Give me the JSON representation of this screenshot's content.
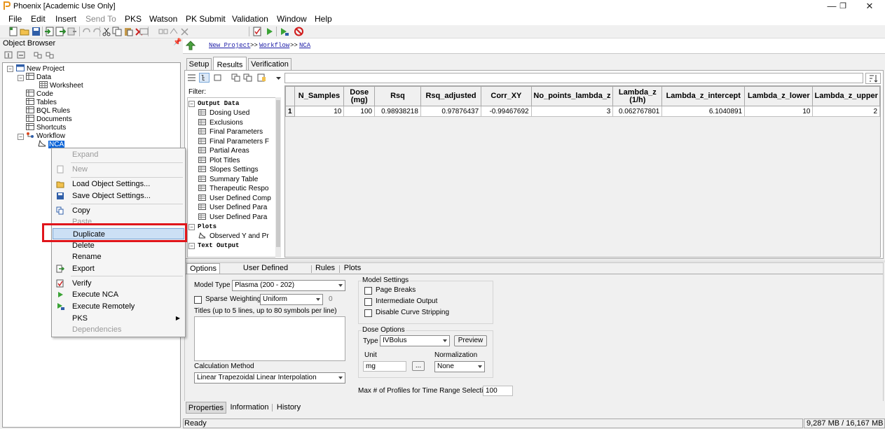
{
  "window": {
    "title": "Phoenix [Academic Use Only]"
  },
  "menu": [
    "File",
    "Edit",
    "Insert",
    "Send To",
    "PKS",
    "Watson",
    "PK Submit",
    "Validation",
    "Window",
    "Help"
  ],
  "object_browser": {
    "title": "Object Browser",
    "tree": [
      {
        "label": "New Project"
      },
      {
        "label": "Data"
      },
      {
        "label": "Worksheet"
      },
      {
        "label": "Code"
      },
      {
        "label": "Tables"
      },
      {
        "label": "BQL Rules"
      },
      {
        "label": "Documents"
      },
      {
        "label": "Shortcuts"
      },
      {
        "label": "Workflow"
      },
      {
        "label": "NCA"
      }
    ]
  },
  "context_menu": {
    "items": [
      {
        "label": "Expand"
      },
      {
        "label": "New"
      },
      {
        "label": "Load Object Settings..."
      },
      {
        "label": "Save Object Settings..."
      },
      {
        "label": "Copy"
      },
      {
        "label": "Paste"
      },
      {
        "label": "Duplicate"
      },
      {
        "label": "Delete"
      },
      {
        "label": "Rename"
      },
      {
        "label": "Export"
      },
      {
        "label": "Verify"
      },
      {
        "label": "Execute NCA"
      },
      {
        "label": "Execute Remotely"
      },
      {
        "label": "PKS"
      },
      {
        "label": "Dependencies"
      }
    ]
  },
  "breadcrumb": [
    "New Project",
    "Workflow",
    "NCA"
  ],
  "breadcrumb_sep": ">>",
  "top_tabs": [
    "Setup",
    "Results",
    "Verification"
  ],
  "results": {
    "filter_label": "Filter:",
    "output_tree": [
      {
        "label": "Output Data"
      },
      {
        "label": "Dosing Used"
      },
      {
        "label": "Exclusions"
      },
      {
        "label": "Final Parameters"
      },
      {
        "label": "Final Parameters F"
      },
      {
        "label": "Partial Areas"
      },
      {
        "label": "Plot Titles"
      },
      {
        "label": "Slopes Settings"
      },
      {
        "label": "Summary Table"
      },
      {
        "label": "Therapeutic Respo"
      },
      {
        "label": "User Defined Comp"
      },
      {
        "label": "User Defined Para"
      },
      {
        "label": "User Defined Para"
      },
      {
        "label": "Plots"
      },
      {
        "label": "Observed Y and Pr"
      },
      {
        "label": "Text Output"
      }
    ],
    "grid": {
      "columns": [
        "N_Samples",
        "Dose (mg)",
        "Rsq",
        "Rsq_adjusted",
        "Corr_XY",
        "No_points_lambda_z",
        "Lambda_z (1/h)",
        "Lambda_z_intercept",
        "Lambda_z_lower",
        "Lambda_z_upper"
      ],
      "rows": [
        [
          "1",
          "10",
          "100",
          "0.98938218",
          "0.97876437",
          "-0.99467692",
          "3",
          "0.062767801",
          "6.1040891",
          "10",
          "2"
        ]
      ]
    }
  },
  "props": {
    "tabs": [
      "Options",
      "User Defined Parameters",
      "Rules",
      "Plots"
    ],
    "model_type_label": "Model Type",
    "model_type_value": "Plasma (200 - 202)",
    "sparse_label": "Sparse",
    "weighting_label": "Weighting",
    "weighting_value": "Uniform",
    "weighting_num": "0",
    "titles_label": "Titles (up to 5 lines, up to 80 symbols per line)",
    "calc_method_label": "Calculation Method",
    "calc_method_value": "Linear Trapezoidal Linear Interpolation",
    "model_settings_title": "Model Settings",
    "page_breaks": "Page Breaks",
    "intermediate_output": "Intermediate Output",
    "disable_curve_stripping": "Disable Curve Stripping",
    "dose_options_title": "Dose Options",
    "type_label": "Type",
    "type_value": "IVBolus",
    "preview_button": "Preview",
    "unit_label": "Unit",
    "unit_value": "mg",
    "browse_button": "...",
    "normalization_label": "Normalization",
    "normalization_value": "None",
    "max_profiles_label": "Max # of Profiles for Time Range Selections",
    "max_profiles_value": "100"
  },
  "bottom_tabs": [
    "Properties",
    "Information",
    "History"
  ],
  "status": {
    "ready": "Ready",
    "memory": "9,287 MB / 16,167 MB"
  }
}
